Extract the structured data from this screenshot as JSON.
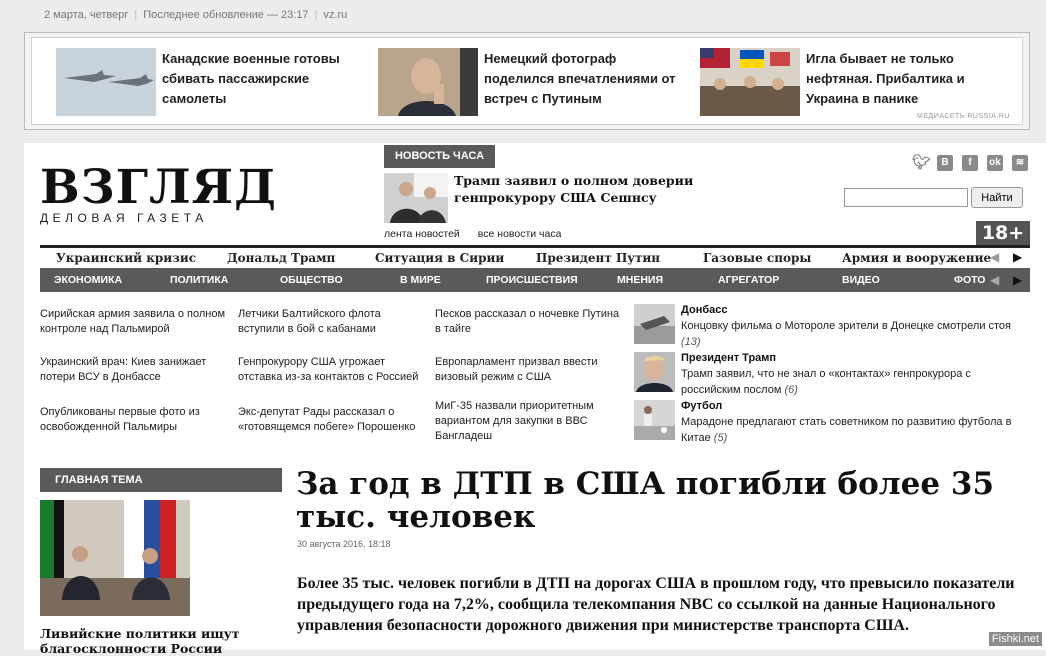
{
  "topbar": {
    "date": "2 марта, четверг",
    "updated": "Последнее обновление — 23:17",
    "site": "vz.ru"
  },
  "promo": {
    "items": [
      {
        "text": "Канадские военные готовы сбивать пассажирские самолеты"
      },
      {
        "text": "Немецкий фотограф поделился впечатлениями от встреч с Путиным"
      },
      {
        "text": "Игла бывает не только нефтяная. Прибалтика и Украина в панике"
      }
    ],
    "footer": "МЕДИАСЕТЬ  RUSSIA.RU"
  },
  "logo": {
    "title": "ВЗГЛЯД",
    "subtitle": "ДЕЛОВАЯ ГАЗЕТА"
  },
  "hour_news": {
    "label": "НОВОСТЬ ЧАСА",
    "text": "Трамп заявил о полном доверии генпрокурору США Сешнсу",
    "links": [
      "лента новостей",
      "все новости часа"
    ]
  },
  "social": [
    "twitter-icon",
    "vkontakte-icon",
    "facebook-icon",
    "odnoklassniki-icon",
    "rss-icon"
  ],
  "search": {
    "button": "Найти",
    "placeholder": ""
  },
  "age_badge": "18+",
  "nav_top": [
    "Украинский кризис",
    "Дональд Трамп",
    "Ситуация в Сирии",
    "Президент Путин",
    "Газовые споры",
    "Армия и вооружение"
  ],
  "nav_sections": [
    "ЭКОНОМИКА",
    "ПОЛИТИКА",
    "ОБЩЕСТВО",
    "В МИРЕ",
    "ПРОИСШЕСТВИЯ",
    "МНЕНИЯ",
    "АГРЕГАТОР",
    "ВИДЕО",
    "ФОТО"
  ],
  "news_columns": [
    [
      "Сирийская армия заявила о полном контроле над Пальмирой",
      "Украинский врач: Киев занижает потери ВСУ в Донбассе",
      "Опубликованы первые фото из освобожденной Пальмиры"
    ],
    [
      "Летчики Балтийского флота вступили в бой с кабанами",
      "Генпрокурору США угрожает отставка из-за контактов с Россией",
      "Экс-депутат Рады рассказал о «готовящемся побеге» Порошенко"
    ],
    [
      "Песков рассказал о ночевке Путина в тайге",
      "Европарламент призвал ввести визовый режим с США",
      "МиГ-35 назвали приоритетным вариантом для закупки в ВВС Бангладеш"
    ]
  ],
  "right_news": [
    {
      "category": "Донбасс",
      "text": "Концовку фильма о Мотороле зрители в Донецке смотрели стоя",
      "count": "13"
    },
    {
      "category": "Президент Трамп",
      "text": "Трамп заявил, что не знал о «контактах» генпрокурора с российским послом",
      "count": "6"
    },
    {
      "category": "Футбол",
      "text": "Марадоне предлагают стать советником по развитию футбола в Китае",
      "count": "5"
    }
  ],
  "main_topic": {
    "label": "ГЛАВНАЯ ТЕМА",
    "caption": "Ливийские политики ищут благосклонности России"
  },
  "article": {
    "headline": "За год в ДТП в США погибли более 35 тыс. человек",
    "date": "30 августа 2016, 18:18",
    "lead": "Более 35 тыс. человек погибли в ДТП на дорогах США в прошлом году, что превысило показатели предыдущего года на 7,2%, сообщила телекомпания NBC со ссылкой на данные Национального управления безопасности дорожного движения при министерстве транспорта США."
  },
  "watermark": "Fishki.net"
}
